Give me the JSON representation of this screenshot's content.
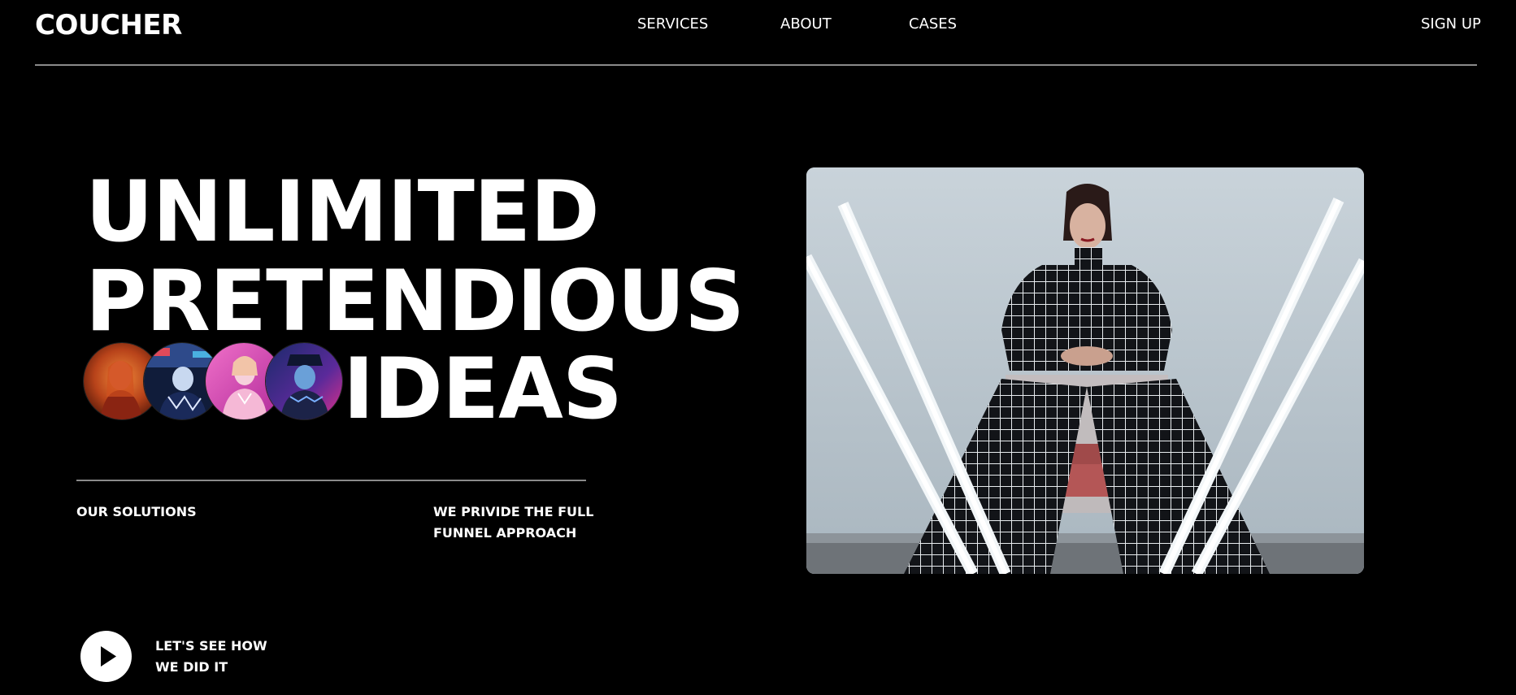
{
  "header": {
    "logo": "COUCHER",
    "nav": [
      "SERVICES",
      "ABOUT",
      "CASES"
    ],
    "signup": "SIGN UP"
  },
  "hero": {
    "line1": "UNLIMITED",
    "line2": "PRETENDIOUS",
    "line3": "IDEAS"
  },
  "captions": {
    "solutions": "OUR SOLUTIONS",
    "funnel_line1": "WE PRIVIDE THE FULL",
    "funnel_line2": "FUNNEL APPROACH"
  },
  "video": {
    "line1": "LET'S SEE HOW",
    "line2": "WE DID IT"
  },
  "colors": {
    "background": "#000000",
    "text": "#ffffff",
    "rule": "#8a8a8a"
  }
}
